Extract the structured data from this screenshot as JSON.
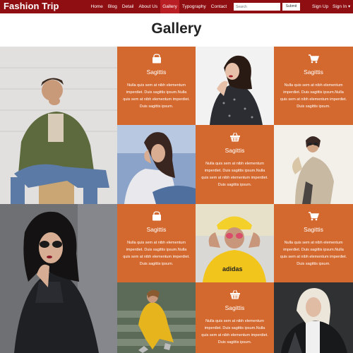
{
  "navbar": {
    "brand": "Fashion Trip",
    "links": [
      "Home",
      "Blog",
      "Detail",
      "About Us",
      "Gallery",
      "Typography",
      "Contact"
    ],
    "active_link": "Gallery",
    "search_placeholder": "Search",
    "search_button": "Submit",
    "sign_up": "Sign Up",
    "sign_in": "Sign In ▾"
  },
  "page": {
    "title": "Gallery"
  },
  "tiles": [
    {
      "icon": "shopping-bag-icon",
      "title": "Sagittis",
      "body": "Nulla quis sem at nibh elementum imperdiet. Duis sagittis ipsum.Nulla quis sem at nibh elementum imperdiet. Duis sagittis ipsum."
    },
    {
      "icon": "cart-icon",
      "title": "Sagittis",
      "body": "Nulla quis sem at nibh elementum imperdiet. Duis sagittis ipsum.Nulla quis sem at nibh elementum imperdiet. Duis sagittis ipsum."
    },
    {
      "icon": "basket-icon",
      "title": "Sagittis",
      "body": "Nulla quis sem at nibh elementum imperdiet. Duis sagittis ipsum.Nulla quis sem at nibh elementum imperdiet. Duis sagittis ipsum."
    },
    {
      "icon": "shopping-bag-icon",
      "title": "Sagittis",
      "body": "Nulla quis sem at nibh elementum imperdiet. Duis sagittis ipsum.Nulla quis sem at nibh elementum imperdiet. Duis sagittis ipsum."
    },
    {
      "icon": "cart-icon",
      "title": "Sagittis",
      "body": "Nulla quis sem at nibh elementum imperdiet. Duis sagittis ipsum.Nulla quis sem at nibh elementum imperdiet. Duis sagittis ipsum."
    },
    {
      "icon": "basket-icon",
      "title": "Sagittis",
      "body": "Nulla quis sem at nibh elementum imperdiet. Duis sagittis ipsum.Nulla quis sem at nibh elementum imperdiet. Duis sagittis ipsum."
    }
  ],
  "colors": {
    "navbar": "#8e0e12",
    "active_nav": "#b91e24",
    "tile": "#d4692f"
  }
}
